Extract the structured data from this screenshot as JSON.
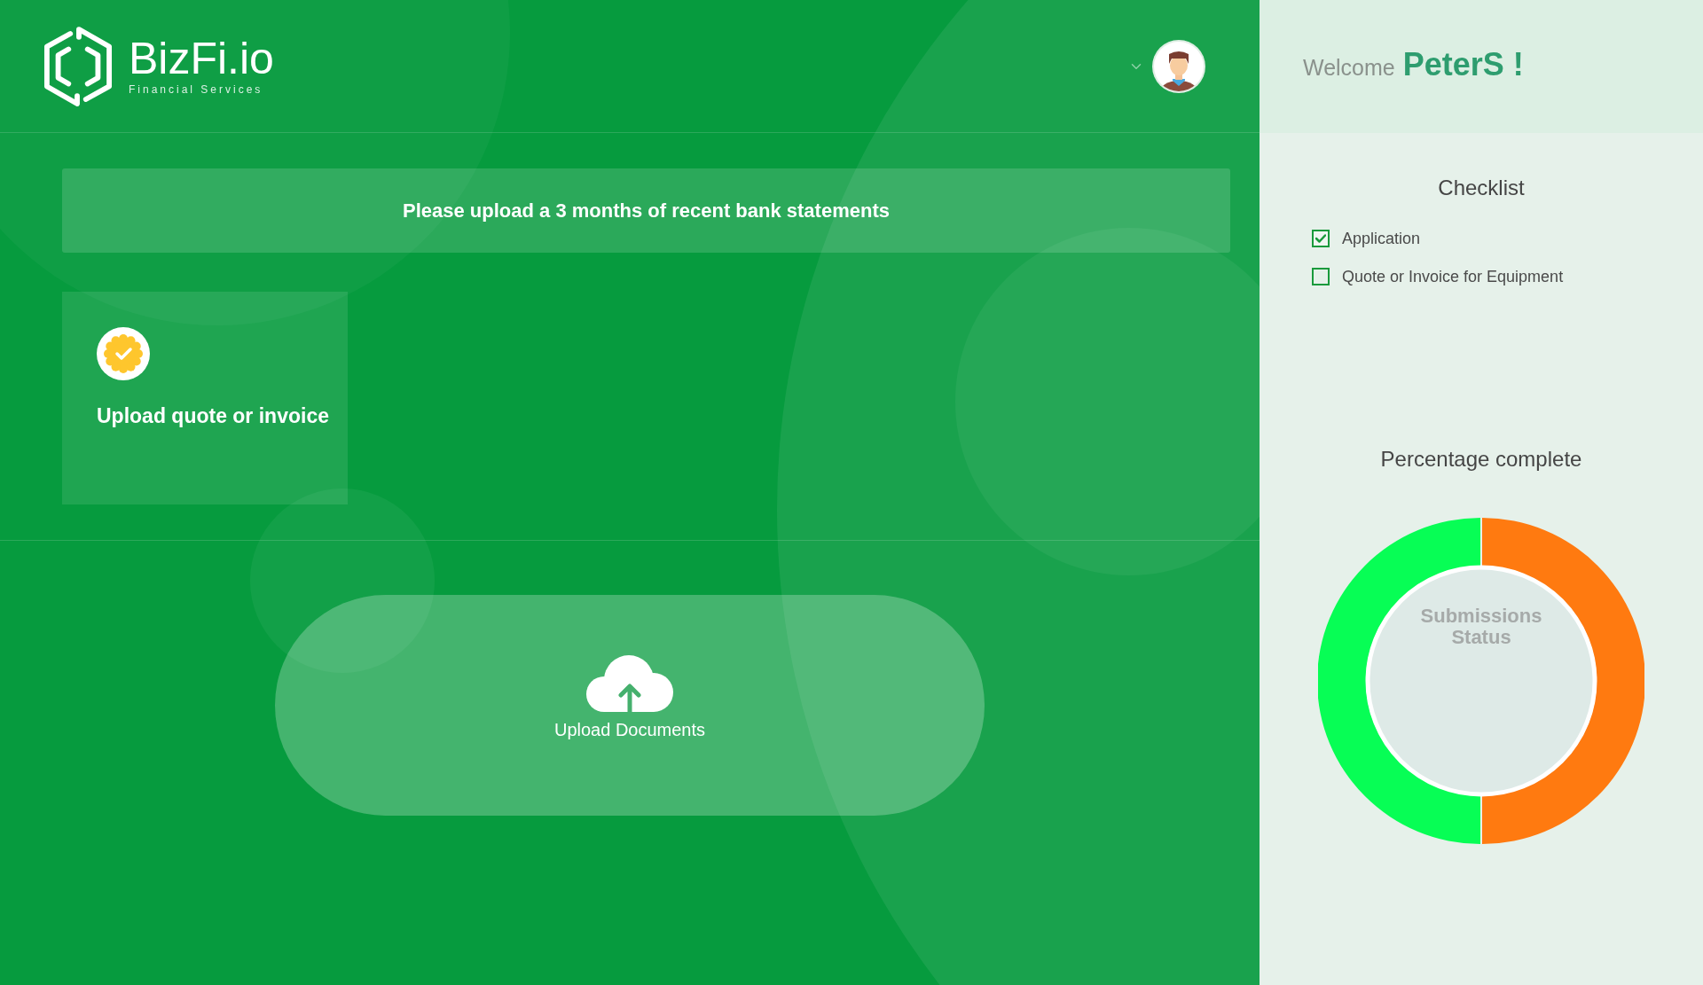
{
  "header": {
    "logo": {
      "name": "BizFi.io",
      "tagline": "Financial Services"
    }
  },
  "banner": {
    "text": "Please upload a 3 months of recent bank statements"
  },
  "tasks": [
    {
      "label": "Upload quote or invoice"
    }
  ],
  "upload": {
    "label": "Upload Documents"
  },
  "welcome": {
    "greeting": "Welcome",
    "name": "PeterS !"
  },
  "checklist": {
    "title": "Checklist",
    "items": [
      {
        "label": "Application",
        "checked": true
      },
      {
        "label": "Quote or Invoice for Equipment",
        "checked": false
      }
    ]
  },
  "progress": {
    "title": "Percentage complete",
    "center_label": "Submissions Status"
  }
}
